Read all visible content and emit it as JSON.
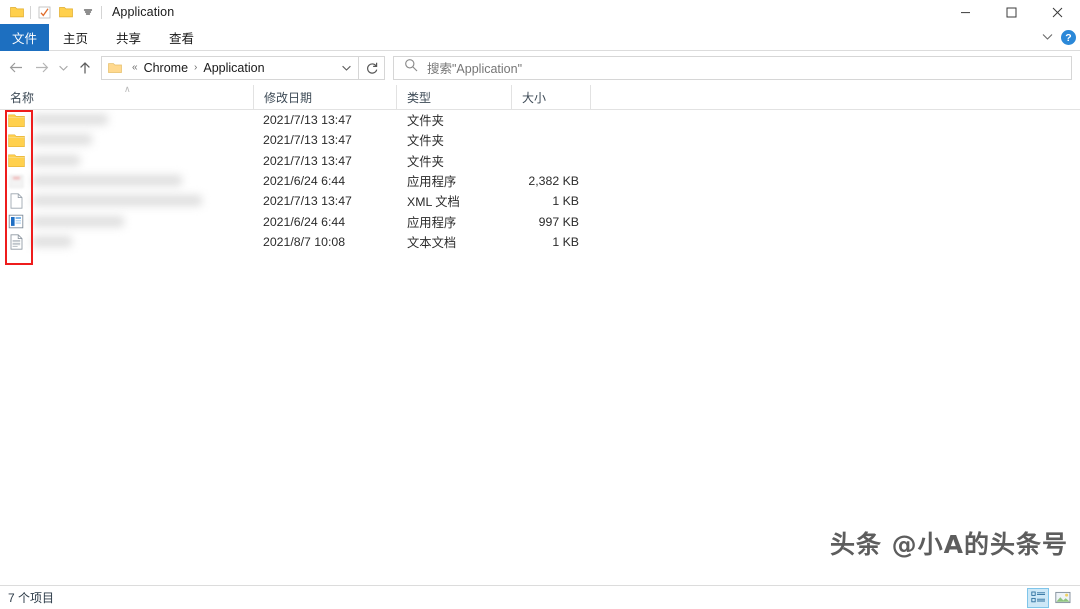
{
  "window": {
    "title": "Application",
    "controls": {
      "minimize": "─",
      "maximize": "□",
      "close": "✕"
    }
  },
  "quick_access": {
    "items": [
      {
        "name": "folder-icon",
        "label": ""
      },
      {
        "name": "properties-icon",
        "label": ""
      },
      {
        "name": "new-folder-icon",
        "label": ""
      },
      {
        "name": "customize-dropdown-icon",
        "label": "▾"
      }
    ]
  },
  "ribbon": {
    "tabs": [
      {
        "label": "文件",
        "active": true
      },
      {
        "label": "主页",
        "active": false
      },
      {
        "label": "共享",
        "active": false
      },
      {
        "label": "查看",
        "active": false
      }
    ],
    "collapse_chevron": "⌄",
    "help_label": "?"
  },
  "navbar": {
    "back": "←",
    "forward": "→",
    "recent": "⌄",
    "up": "↑",
    "breadcrumb": {
      "overflow": "«",
      "separator": "›",
      "parts": [
        {
          "label": "Chrome"
        },
        {
          "label": "Application"
        }
      ],
      "dropdown": "⌄"
    },
    "refresh": "↻"
  },
  "search": {
    "placeholder": "搜索\"Application\"",
    "icon": "search-icon"
  },
  "columns": [
    {
      "key": "name",
      "label": "名称",
      "sorted": true,
      "sort_dir": "asc"
    },
    {
      "key": "date",
      "label": "修改日期"
    },
    {
      "key": "type",
      "label": "类型"
    },
    {
      "key": "size",
      "label": "大小"
    }
  ],
  "sort_caret": "∧",
  "files": [
    {
      "icon": "folder-icon",
      "name": "",
      "date": "2021/7/13 13:47",
      "type": "文件夹",
      "size": "",
      "name_blurred": true,
      "smudge_w": 76
    },
    {
      "icon": "folder-icon",
      "name": "",
      "date": "2021/7/13 13:47",
      "type": "文件夹",
      "size": "",
      "name_blurred": true,
      "smudge_w": 60
    },
    {
      "icon": "folder-icon",
      "name": "",
      "date": "2021/7/13 13:47",
      "type": "文件夹",
      "size": "",
      "name_blurred": true,
      "smudge_w": 48
    },
    {
      "icon": "application-icon",
      "name": "",
      "date": "2021/6/24 6:44",
      "type": "应用程序",
      "size": "2,382 KB",
      "name_blurred": true,
      "smudge_w": 150
    },
    {
      "icon": "xml-document-icon",
      "name": "",
      "date": "2021/7/13 13:47",
      "type": "XML 文档",
      "size": "1 KB",
      "name_blurred": true,
      "smudge_w": 170
    },
    {
      "icon": "application-blue-icon",
      "name": "",
      "date": "2021/6/24 6:44",
      "type": "应用程序",
      "size": "997 KB",
      "name_blurred": true,
      "smudge_w": 92
    },
    {
      "icon": "text-document-icon",
      "name": "",
      "date": "2021/8/7 10:08",
      "type": "文本文档",
      "size": "1 KB",
      "name_blurred": true,
      "smudge_w": 40
    }
  ],
  "annotation": {
    "type": "red-rectangle",
    "color": "#ee1c1c",
    "target": "file-icon-column"
  },
  "watermark": {
    "text": "头条 @小A的头条号"
  },
  "statusbar": {
    "item_count": "7 个项目",
    "views": [
      {
        "name": "details-view",
        "active": true
      },
      {
        "name": "large-icons-view",
        "active": false
      }
    ]
  },
  "colors": {
    "accent": "#1d6fc0",
    "folder": "#ffd04d",
    "annotation": "#ee1c1c",
    "help": "#2b88d8"
  }
}
